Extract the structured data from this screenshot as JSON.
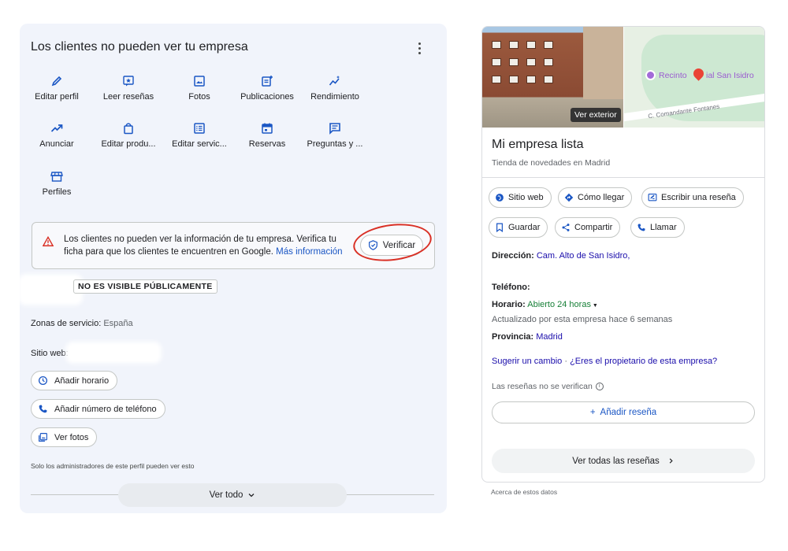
{
  "left_panel": {
    "title": "Los clientes no pueden ver tu empresa",
    "actions": [
      {
        "label": "Editar perfil",
        "icon": "pencil-icon"
      },
      {
        "label": "Leer reseñas",
        "icon": "star-review-icon"
      },
      {
        "label": "Fotos",
        "icon": "photo-icon"
      },
      {
        "label": "Publicaciones",
        "icon": "post-add-icon"
      },
      {
        "label": "Rendimiento",
        "icon": "sparkle-chart-icon"
      },
      {
        "label": "Anunciar",
        "icon": "trending-up-icon"
      },
      {
        "label": "Editar produ...",
        "icon": "shopping-bag-icon"
      },
      {
        "label": "Editar servic...",
        "icon": "list-alt-icon"
      },
      {
        "label": "Reservas",
        "icon": "calendar-icon"
      },
      {
        "label": "Preguntas y ...",
        "icon": "chat-icon"
      },
      {
        "label": "Perfiles",
        "icon": "storefront-icon"
      }
    ],
    "alert": {
      "message": "Los clientes no pueden ver la información de tu empresa. Verifica tu ficha para que los clientes te encuentren en Google.",
      "link": "Más información",
      "verify_label": "Verificar"
    },
    "badge": "NO ES VISIBLE PÚBLICAMENTE",
    "service_areas_label": "Zonas de servicio:",
    "service_areas_value": "España",
    "website_label": "Sitio web:",
    "chips": {
      "hours": "Añadir horario",
      "phone": "Añadir número de teléfono",
      "photos": "Ver fotos"
    },
    "admin_note": "Solo los administradores de este perfil pueden ver esto",
    "see_all": "Ver todo"
  },
  "card": {
    "photo_label": "Ver exterior",
    "map": {
      "poi": "Recinto",
      "poi_suffix": "ial San Isidro",
      "street": "C. Comandante Fontanes"
    },
    "name": "Mi empresa lista",
    "category": "Tienda de novedades en Madrid",
    "buttons": {
      "website": "Sitio web",
      "directions": "Cómo llegar",
      "write_review": "Escribir una reseña",
      "save": "Guardar",
      "share": "Compartir",
      "call": "Llamar"
    },
    "address_label": "Dirección:",
    "address_value": "Cam. Alto de San Isidro,",
    "phone_label": "Teléfono:",
    "hours_label": "Horario:",
    "hours_value": "Abierto 24 horas",
    "updated_note": "Actualizado por esta empresa hace 6 semanas",
    "province_label": "Provincia:",
    "province_value": "Madrid",
    "suggest_change": "Sugerir un cambio",
    "owner_question": "¿Eres el propietario de esta empresa?",
    "reviews_unverified": "Las reseñas no se verifican",
    "add_review": "Añadir reseña",
    "all_reviews": "Ver todas las reseñas"
  },
  "about_data": "Acerca de estos datos",
  "colors": {
    "accent_blue": "#1a56c4",
    "link_blue": "#1a0dab",
    "open_green": "#188038",
    "alert_red": "#d93025",
    "panel_bg": "#f1f4fb"
  }
}
